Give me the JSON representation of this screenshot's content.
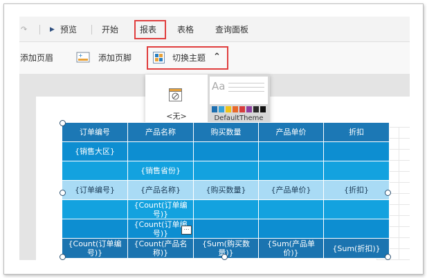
{
  "ribbon": {
    "tabs": [
      {
        "label": "预览"
      },
      {
        "label": "开始"
      },
      {
        "label": "报表"
      },
      {
        "label": "表格"
      },
      {
        "label": "查询面板"
      }
    ]
  },
  "toolbar": {
    "add_header": "添加页眉",
    "add_footer": "添加页脚",
    "switch_theme": "切换主题"
  },
  "theme_dropdown": {
    "none_label": "<无>",
    "default_label": "DefaultTheme",
    "preview_text": "Aa",
    "swatches": [
      "#1e6fb0",
      "#36a3d9",
      "#f0c419",
      "#e8682a",
      "#d63c3c",
      "#8e3fa0",
      "#2a2a2a",
      "#111111"
    ]
  },
  "report": {
    "header": [
      "订单编号",
      "产品名称",
      "购买数量",
      "产品单价",
      "折扣"
    ],
    "rows": [
      [
        "{销售大区}",
        "",
        "",
        "",
        ""
      ],
      [
        "",
        "{销售省份}",
        "",
        "",
        ""
      ],
      [
        "{订单编号}",
        "{产品名称}",
        "{购买数量}",
        "{产品单价}",
        "{折扣}"
      ],
      [
        "",
        "{Count(订单编号)}",
        "",
        "",
        ""
      ],
      [
        "",
        "{Count(订单编号)}",
        "",
        "",
        ""
      ],
      [
        "{Count(订单编号)}",
        "{Count(产品名称)}",
        "{Sum(购买数量)}",
        "{Sum(产品单价)}",
        "{Sum(折扣)}"
      ]
    ]
  }
}
